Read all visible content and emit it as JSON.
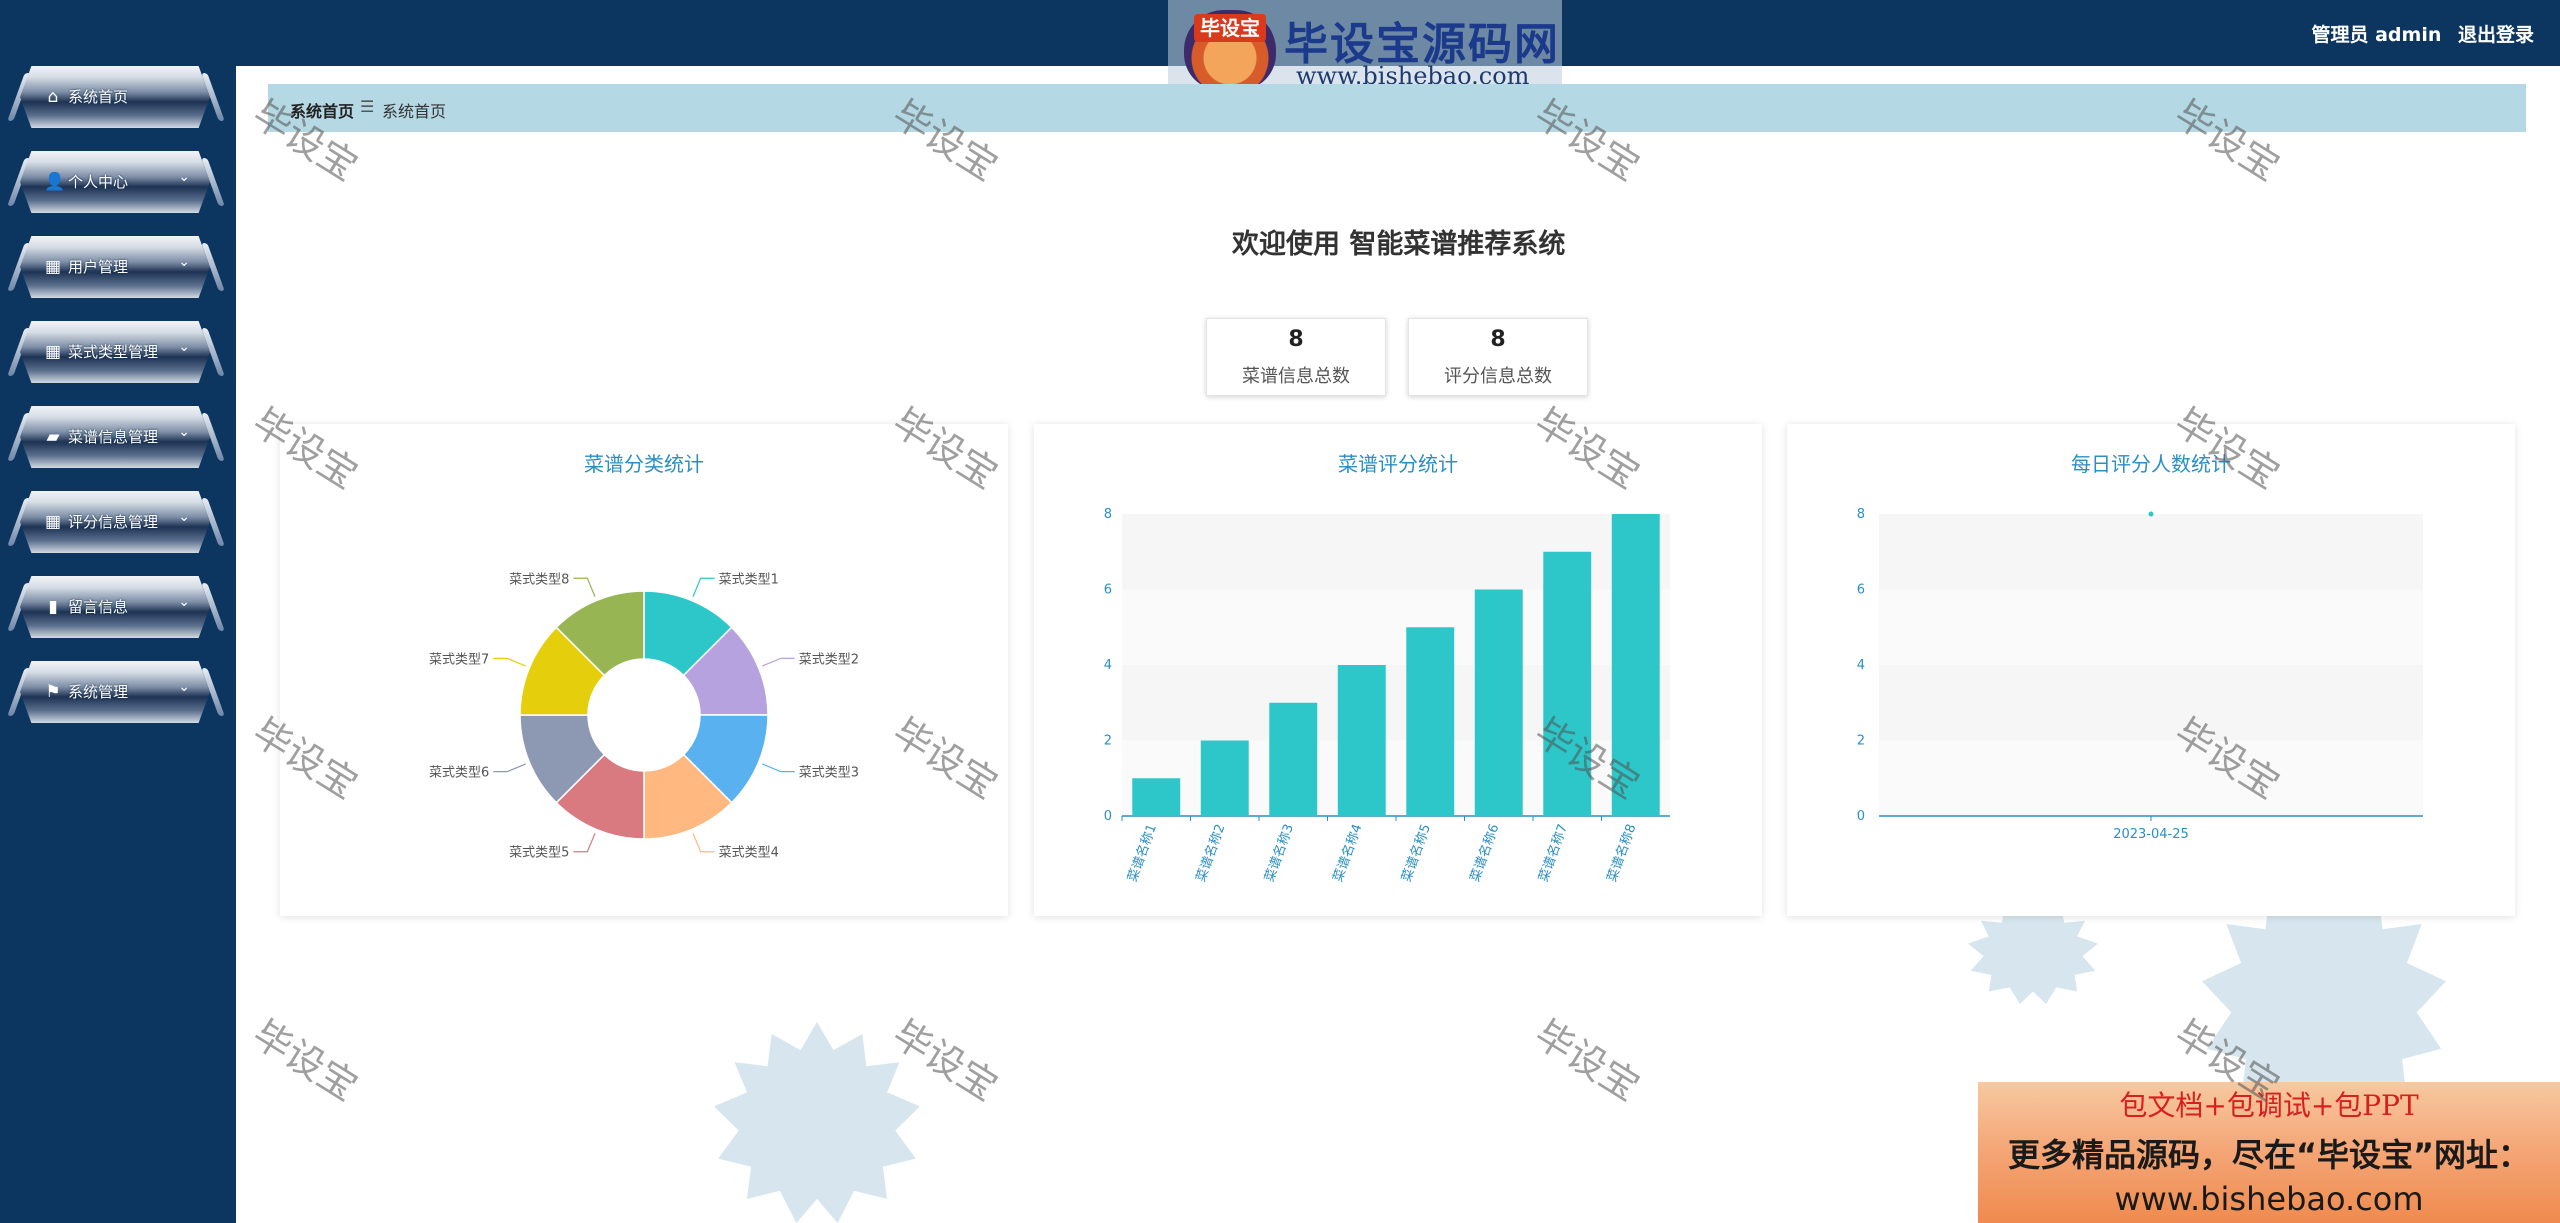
{
  "header": {
    "logo_badge": "毕设宝",
    "logo_title": "毕设宝源码网",
    "logo_url": "www.bishebao.com",
    "user_label": "管理员 admin",
    "logout_label": "退出登录"
  },
  "sidebar": {
    "items": [
      {
        "label": "系统首页",
        "icon": "home-icon",
        "has_arrow": false
      },
      {
        "label": "个人中心",
        "icon": "user-icon",
        "has_arrow": true
      },
      {
        "label": "用户管理",
        "icon": "grid-icon",
        "has_arrow": true
      },
      {
        "label": "菜式类型管理",
        "icon": "grid-icon",
        "has_arrow": true
      },
      {
        "label": "菜谱信息管理",
        "icon": "wallet-icon",
        "has_arrow": true
      },
      {
        "label": "评分信息管理",
        "icon": "grid-icon",
        "has_arrow": true
      },
      {
        "label": "留言信息",
        "icon": "bar-chart-icon",
        "has_arrow": true
      },
      {
        "label": "系统管理",
        "icon": "flag-icon",
        "has_arrow": true
      }
    ]
  },
  "breadcrumb": {
    "home": "系统首页",
    "separator": "☰",
    "current": "系统首页"
  },
  "welcome": "欢迎使用 智能菜谱推荐系统",
  "stats": [
    {
      "value": "8",
      "label": "菜谱信息总数"
    },
    {
      "value": "8",
      "label": "评分信息总数"
    }
  ],
  "panels": {
    "pie_title": "菜谱分类统计",
    "bar_title": "菜谱评分统计",
    "line_title": "每日评分人数统计"
  },
  "watermark": "毕设宝",
  "promo": {
    "line1": "包文档+包调试+包PPT",
    "line2": "更多精品源码，尽在“毕设宝”网址：",
    "line3": "www.bishebao.com"
  },
  "chart_data": [
    {
      "type": "pie",
      "title": "菜谱分类统计",
      "donut": true,
      "categories": [
        "菜式类型1",
        "菜式类型2",
        "菜式类型3",
        "菜式类型4",
        "菜式类型5",
        "菜式类型6",
        "菜式类型7",
        "菜式类型8"
      ],
      "values": [
        1,
        1,
        1,
        1,
        1,
        1,
        1,
        1
      ],
      "colors": [
        "#2ec7c9",
        "#b6a2de",
        "#5ab1ef",
        "#ffb980",
        "#d87a80",
        "#8d98b3",
        "#e5cf0d",
        "#97b552"
      ]
    },
    {
      "type": "bar",
      "title": "菜谱评分统计",
      "categories": [
        "菜谱名称1",
        "菜谱名称2",
        "菜谱名称3",
        "菜谱名称4",
        "菜谱名称5",
        "菜谱名称6",
        "菜谱名称7",
        "菜谱名称8"
      ],
      "values": [
        1,
        2,
        3,
        4,
        5,
        6,
        7,
        8
      ],
      "ylim": [
        0,
        8
      ],
      "yticks": [
        0,
        2,
        4,
        6,
        8
      ],
      "color": "#2ec7c9",
      "grid": true
    },
    {
      "type": "line",
      "title": "每日评分人数统计",
      "x": [
        "2023-04-25"
      ],
      "y": [
        8
      ],
      "ylim": [
        0,
        8
      ],
      "yticks": [
        0,
        2,
        4,
        6,
        8
      ],
      "color": "#2ec7c9",
      "grid": true
    }
  ]
}
